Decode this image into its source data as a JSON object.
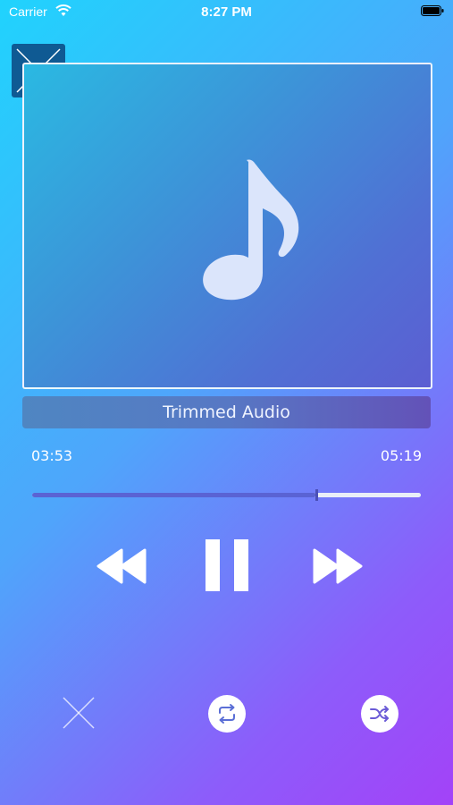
{
  "status_bar": {
    "carrier": "Carrier",
    "time": "8:27 PM",
    "wifi_icon": "wifi-icon",
    "battery_icon": "battery-icon"
  },
  "player": {
    "track_title": "Trimmed Audio",
    "time_elapsed": "03:53",
    "time_total": "05:19",
    "progress_fraction": 0.73,
    "artwork_icon": "music-note-icon"
  },
  "controls": {
    "rewind_icon": "rewind-icon",
    "pause_icon": "pause-icon",
    "forward_icon": "fast-forward-icon",
    "close_icon": "close-icon",
    "repeat_icon": "repeat-icon",
    "shuffle_icon": "shuffle-icon"
  },
  "colors": {
    "gradient_start": "#20d3fd",
    "gradient_end": "#a342f8",
    "progress_fill": "#5a63d4",
    "close_box": "#0f5a93"
  }
}
